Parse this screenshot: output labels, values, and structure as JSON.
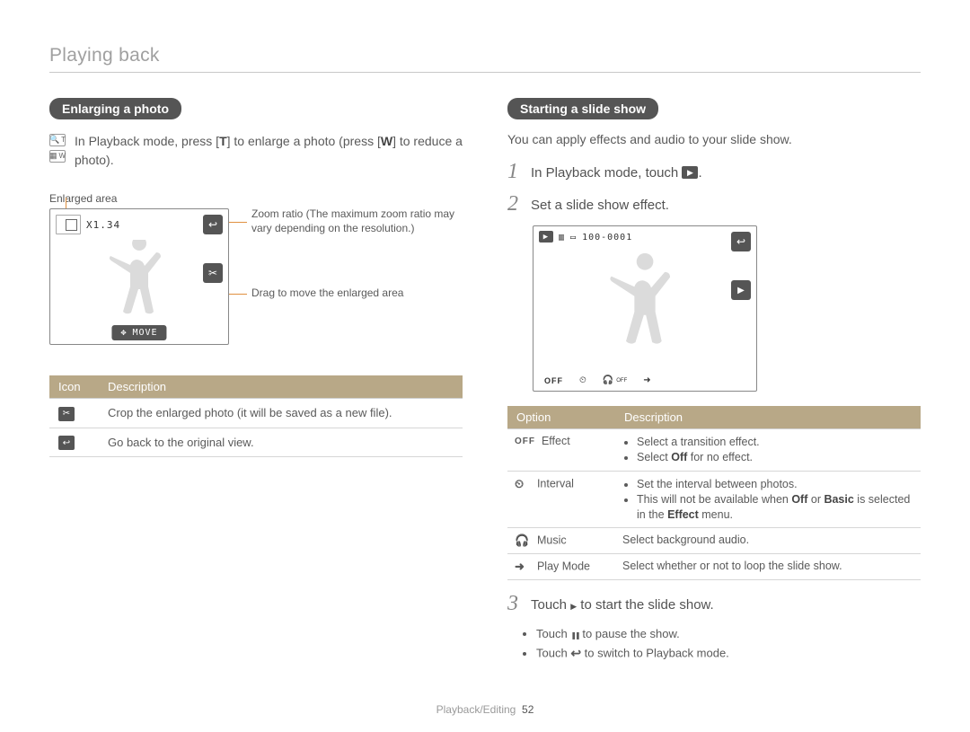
{
  "page_title": "Playing back",
  "footer_section": "Playback/Editing",
  "footer_page": "52",
  "left": {
    "pill": "Enlarging a photo",
    "zoom_instr_part1": "In Playback mode, press [",
    "zoom_T": "T",
    "zoom_instr_part2": "] to enlarge a photo (press [",
    "zoom_W": "W",
    "zoom_instr_part3": "] to reduce a photo).",
    "label_enlarged_area": "Enlarged area",
    "zoom_value": "X1.34",
    "move_label": "MOVE",
    "callout_zoom_ratio": "Zoom ratio (The maximum zoom ratio may vary depending on the resolution.)",
    "callout_drag": "Drag to move the enlarged area",
    "table": {
      "h1": "Icon",
      "h2": "Description",
      "row1": "Crop the enlarged photo (it will be saved as a new file).",
      "row2": "Go back to the original view."
    }
  },
  "right": {
    "pill": "Starting a slide show",
    "intro": "You can apply effects and audio to your slide show.",
    "step1": "In Playback mode, touch",
    "step1_suffix": ".",
    "step2": "Set a slide show effect.",
    "screen_file": "100-0001",
    "screen_off": "OFF",
    "table": {
      "h1": "Option",
      "h2": "Description",
      "effect_icon": "OFF",
      "effect_label": "Effect",
      "effect_d1": "Select a transition effect.",
      "effect_d2_a": "Select ",
      "effect_d2_off": "Off",
      "effect_d2_b": " for no effect.",
      "interval_label": "Interval",
      "interval_d1": "Set the interval between photos.",
      "interval_d2_a": "This will not be available when ",
      "interval_d2_off": "Off",
      "interval_d2_b": " or ",
      "interval_d2_basic": "Basic",
      "interval_d2_c": " is selected in the ",
      "interval_d2_effect": "Effect",
      "interval_d2_d": " menu.",
      "music_label": "Music",
      "music_desc": "Select background audio.",
      "play_label": "Play Mode",
      "play_desc": "Select whether or not to loop the slide show."
    },
    "step3_a": "Touch ",
    "step3_b": " to start the slide show.",
    "sub1_a": "Touch ",
    "sub1_b": " to pause the show.",
    "sub2_a": "Touch ",
    "sub2_b": " to switch to Playback mode."
  }
}
